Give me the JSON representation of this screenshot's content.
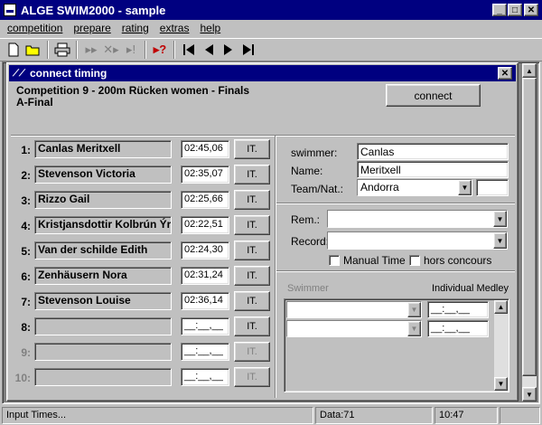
{
  "app": {
    "title": "ALGE SWIM2000 - sample"
  },
  "menu": [
    {
      "label": "competition"
    },
    {
      "label": "prepare"
    },
    {
      "label": "rating"
    },
    {
      "label": "extras"
    },
    {
      "label": "help"
    }
  ],
  "toolbar": [
    {
      "icon": "new-file-icon",
      "glyph": "🗋"
    },
    {
      "icon": "open-folder-icon",
      "glyph": "📂"
    },
    {
      "icon": "print-icon",
      "glyph": "🖶"
    },
    {
      "icon": "split-icon",
      "glyph": "⇢"
    },
    {
      "icon": "cross-split-icon",
      "glyph": "✕"
    },
    {
      "icon": "exclaim-icon",
      "glyph": "!"
    },
    {
      "icon": "help-cursor-icon",
      "glyph": "?"
    },
    {
      "icon": "first-icon",
      "glyph": "⏮"
    },
    {
      "icon": "prev-icon",
      "glyph": "◀"
    },
    {
      "icon": "next-icon",
      "glyph": "▶"
    },
    {
      "icon": "last-icon",
      "glyph": "⏭"
    }
  ],
  "child": {
    "title": "connect timing",
    "heading_line1": "Competition 9 - 200m Rücken women  - Finals",
    "heading_line2": "A-Final",
    "connect_label": "connect"
  },
  "lanes": [
    {
      "num": "1:",
      "name": "Canlas Meritxell",
      "time": "02:45,06",
      "btn": "IT.",
      "enabled": true
    },
    {
      "num": "2:",
      "name": "Stevenson Victoria",
      "time": "02:35,07",
      "btn": "IT.",
      "enabled": true
    },
    {
      "num": "3:",
      "name": "Rizzo Gail",
      "time": "02:25,66",
      "btn": "IT.",
      "enabled": true
    },
    {
      "num": "4:",
      "name": "Kristjansdottir Kolbrún Ýr",
      "time": "02:22,51",
      "btn": "IT.",
      "enabled": true
    },
    {
      "num": "5:",
      "name": "Van der schilde Edith",
      "time": "02:24,30",
      "btn": "IT.",
      "enabled": true
    },
    {
      "num": "6:",
      "name": "Zenhäusern Nora",
      "time": "02:31,24",
      "btn": "IT.",
      "enabled": true
    },
    {
      "num": "7:",
      "name": "Stevenson Louise",
      "time": "02:36,14",
      "btn": "IT.",
      "enabled": true
    },
    {
      "num": "8:",
      "name": "",
      "time": "__:__,__",
      "btn": "IT.",
      "enabled": true
    },
    {
      "num": "9:",
      "name": "",
      "time": "__:__,__",
      "btn": "IT.",
      "enabled": false
    },
    {
      "num": "10:",
      "name": "",
      "time": "__:__,__",
      "btn": "IT.",
      "enabled": false
    }
  ],
  "swimmer": {
    "swimmer_label": "swimmer:",
    "swimmer_value": "Canlas",
    "name_label": "Name:",
    "name_value": "Meritxell",
    "team_label": "Team/Nat.:",
    "team_value": "Andorra",
    "nat_value": ""
  },
  "remarks": {
    "rem_label": "Rem.:",
    "rem_value": "",
    "record_label": "Record:",
    "record_value": "",
    "manual_time_label": "Manual Time",
    "manual_time_checked": false,
    "hors_concours_label": "hors concours",
    "hors_concours_checked": false
  },
  "medley": {
    "swimmer_header": "Swimmer",
    "event_header": "Individual Medley",
    "rows": [
      {
        "swimmer": "",
        "time": "__:__,__"
      },
      {
        "swimmer": "",
        "time": "__:__,__"
      }
    ]
  },
  "status": {
    "left": "Input Times...",
    "data": "Data:71",
    "time": "10:47"
  },
  "colors": {
    "titlebar": "#000080",
    "face": "#c0c0c0"
  }
}
